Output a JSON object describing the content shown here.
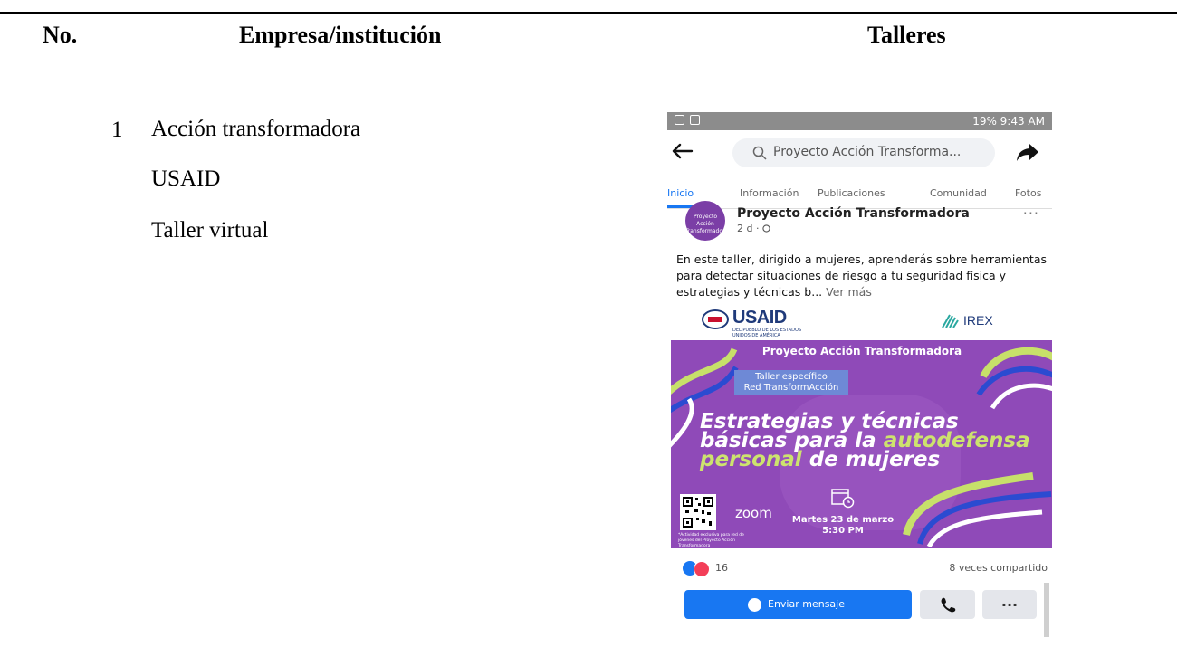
{
  "table": {
    "headers": {
      "no": "No.",
      "empresa": "Empresa/institución",
      "talleres": "Talleres"
    },
    "rows": [
      {
        "number": "1",
        "lines": [
          "Acción transformadora",
          "USAID",
          "Taller virtual"
        ]
      }
    ]
  },
  "phone": {
    "status": {
      "right": "19% 9:43 AM"
    },
    "search": {
      "text": "Proyecto Acción Transforma..."
    },
    "tabs": [
      "Inicio",
      "Información",
      "Publicaciones",
      "Comunidad",
      "Fotos"
    ],
    "post": {
      "avatar_text": "Proyecto Acción Transformadora",
      "page_name": "Proyecto Acción Transformadora",
      "meta": "2 d ·",
      "text": "En este taller, dirigido a mujeres, aprenderás sobre herramientas para detectar situaciones de riesgo a tu seguridad física y estrategias y técnicas b... ",
      "see_more": "Ver más"
    },
    "logos": {
      "usaid": "USAID",
      "usaid_sub": "DEL PUEBLO DE LOS ESTADOS UNIDOS DE AMÉRICA",
      "irex": "IREX"
    },
    "banner": {
      "top": "Proyecto Acción Transformadora",
      "pill_line1": "Taller específico",
      "pill_line2": "Red TransformAcción",
      "title_a": "Estrategias y técnicas básicas para la ",
      "title_b": "autodefensa personal",
      "title_c": " de mujeres",
      "zoom": "zoom",
      "date_line1": "Martes 23 de marzo",
      "date_line2": "5:30 PM",
      "foot": "*Actividad exclusiva para red de jóvenes del Proyecto Acción Transformadora"
    },
    "reactions": {
      "count": "16",
      "shares": "8 veces compartido"
    },
    "buttons": {
      "message": "Enviar mensaje",
      "more": "..."
    }
  }
}
